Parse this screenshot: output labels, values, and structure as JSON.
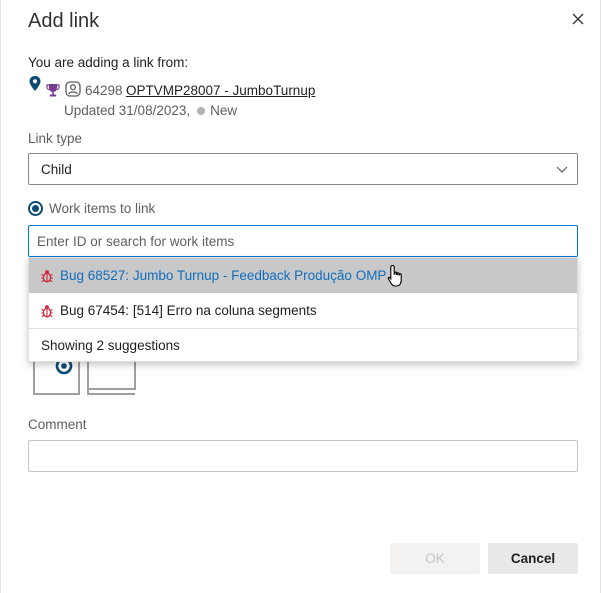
{
  "dialog": {
    "title": "Add link"
  },
  "source": {
    "label": "You are adding a link from:",
    "id": "64298",
    "title": "OPTVMP28007 - JumboTurnup",
    "updated": "Updated 31/08/2023,",
    "state": "New",
    "state_color": "#b2b2b2"
  },
  "link_type": {
    "label": "Link type",
    "value": "Child"
  },
  "work_items": {
    "label": "Work items to link",
    "search_placeholder": "Enter ID or search for work items",
    "suggestions": [
      {
        "text": "Bug 68527: Jumbo Turnup - Feedback Produção OMP",
        "selected": true
      },
      {
        "text": "Bug 67454: [514] Erro na coluna segments",
        "selected": false
      }
    ],
    "count_text": "Showing 2 suggestions"
  },
  "comment": {
    "label": "Comment",
    "value": ""
  },
  "buttons": {
    "ok": "OK",
    "cancel": "Cancel"
  },
  "colors": {
    "accent": "#0078d4",
    "bug": "#cc293d",
    "trophy": "#773b93",
    "link": "#106ebe"
  }
}
